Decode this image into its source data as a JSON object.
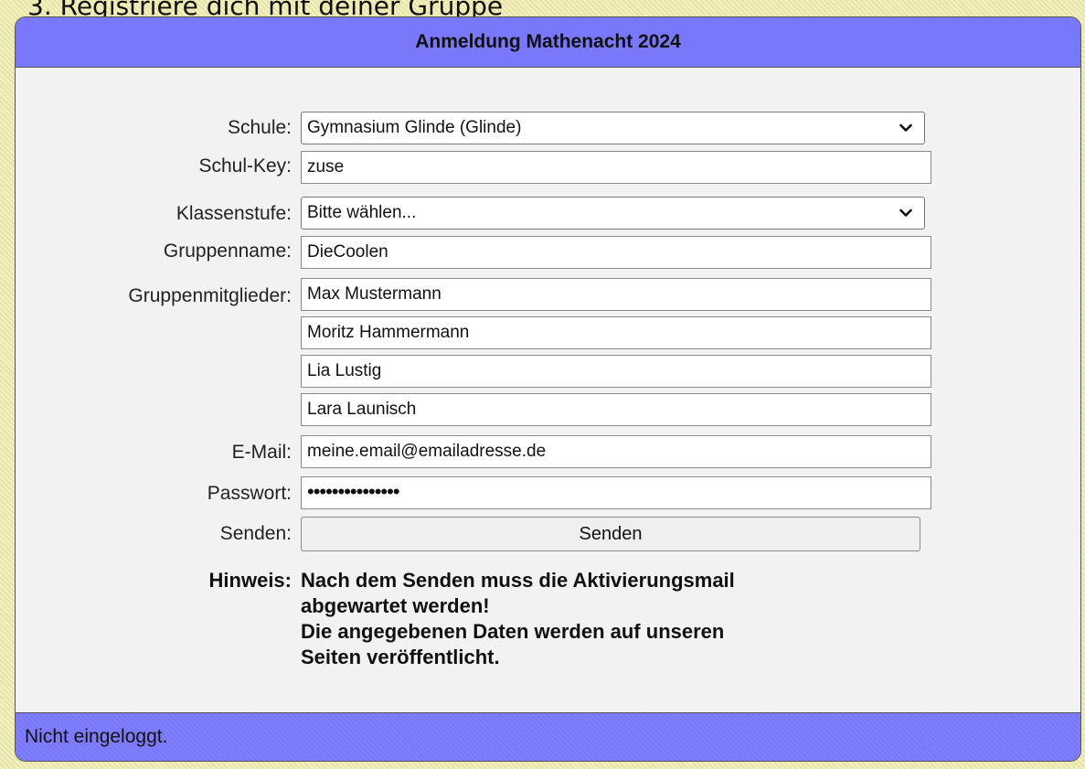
{
  "page": {
    "heading": "3. Registriere dich mit deiner Gruppe"
  },
  "form": {
    "title": "Anmeldung Mathenacht 2024",
    "schule": {
      "label": "Schule:",
      "value": "Gymnasium Glinde (Glinde)"
    },
    "schul_key": {
      "label": "Schul-Key:",
      "value": "zuse"
    },
    "klassenstufe": {
      "label": "Klassenstufe:",
      "value": "Bitte wählen..."
    },
    "gruppenname": {
      "label": "Gruppenname:",
      "value": "DieCoolen"
    },
    "gruppenmitglieder": {
      "label": "Gruppenmitglieder:",
      "members": [
        "Max Mustermann",
        "Moritz Hammermann",
        "Lia Lustig",
        "Lara Launisch"
      ]
    },
    "email": {
      "label": "E-Mail:",
      "value": "meine.email@emailadresse.de"
    },
    "passwort": {
      "label": "Passwort:",
      "masked_value": "•••••••••••••••"
    },
    "senden": {
      "label": "Senden:",
      "button": "Senden"
    },
    "hinweis": {
      "label": "Hinweis:",
      "line1": "Nach dem Senden muss die Aktivierungsmail",
      "line2": "abgewartet werden!",
      "line3": "Die angegebenen Daten werden auf unseren",
      "line4": "Seiten veröffentlicht."
    }
  },
  "footer": {
    "status": "Nicht eingeloggt."
  },
  "icons": {
    "dropdown": "chevron-down-icon"
  },
  "colors": {
    "header_bg": "#7a78fa",
    "panel_bg": "#f2f2f2",
    "page_bg": "#f3efba"
  }
}
